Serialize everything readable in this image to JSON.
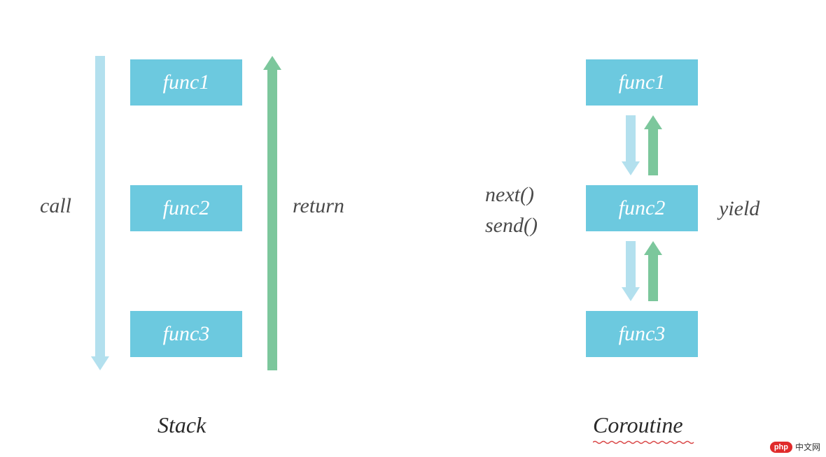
{
  "colors": {
    "box_fill": "#6cc9df",
    "arrow_light": "#b3e0ee",
    "arrow_green": "#7cc79c",
    "label_text": "#4a4a4a",
    "title_text": "#2a2a2a",
    "squiggle": "#d94545"
  },
  "stack": {
    "title": "Stack",
    "call_label": "call",
    "return_label": "return",
    "boxes": [
      "func1",
      "func2",
      "func3"
    ]
  },
  "coroutine": {
    "title": "Coroutine",
    "next_label": "next()",
    "send_label": "send()",
    "yield_label": "yield",
    "boxes": [
      "func1",
      "func2",
      "func3"
    ]
  },
  "watermark": {
    "badge": "php",
    "text": "中文网"
  }
}
